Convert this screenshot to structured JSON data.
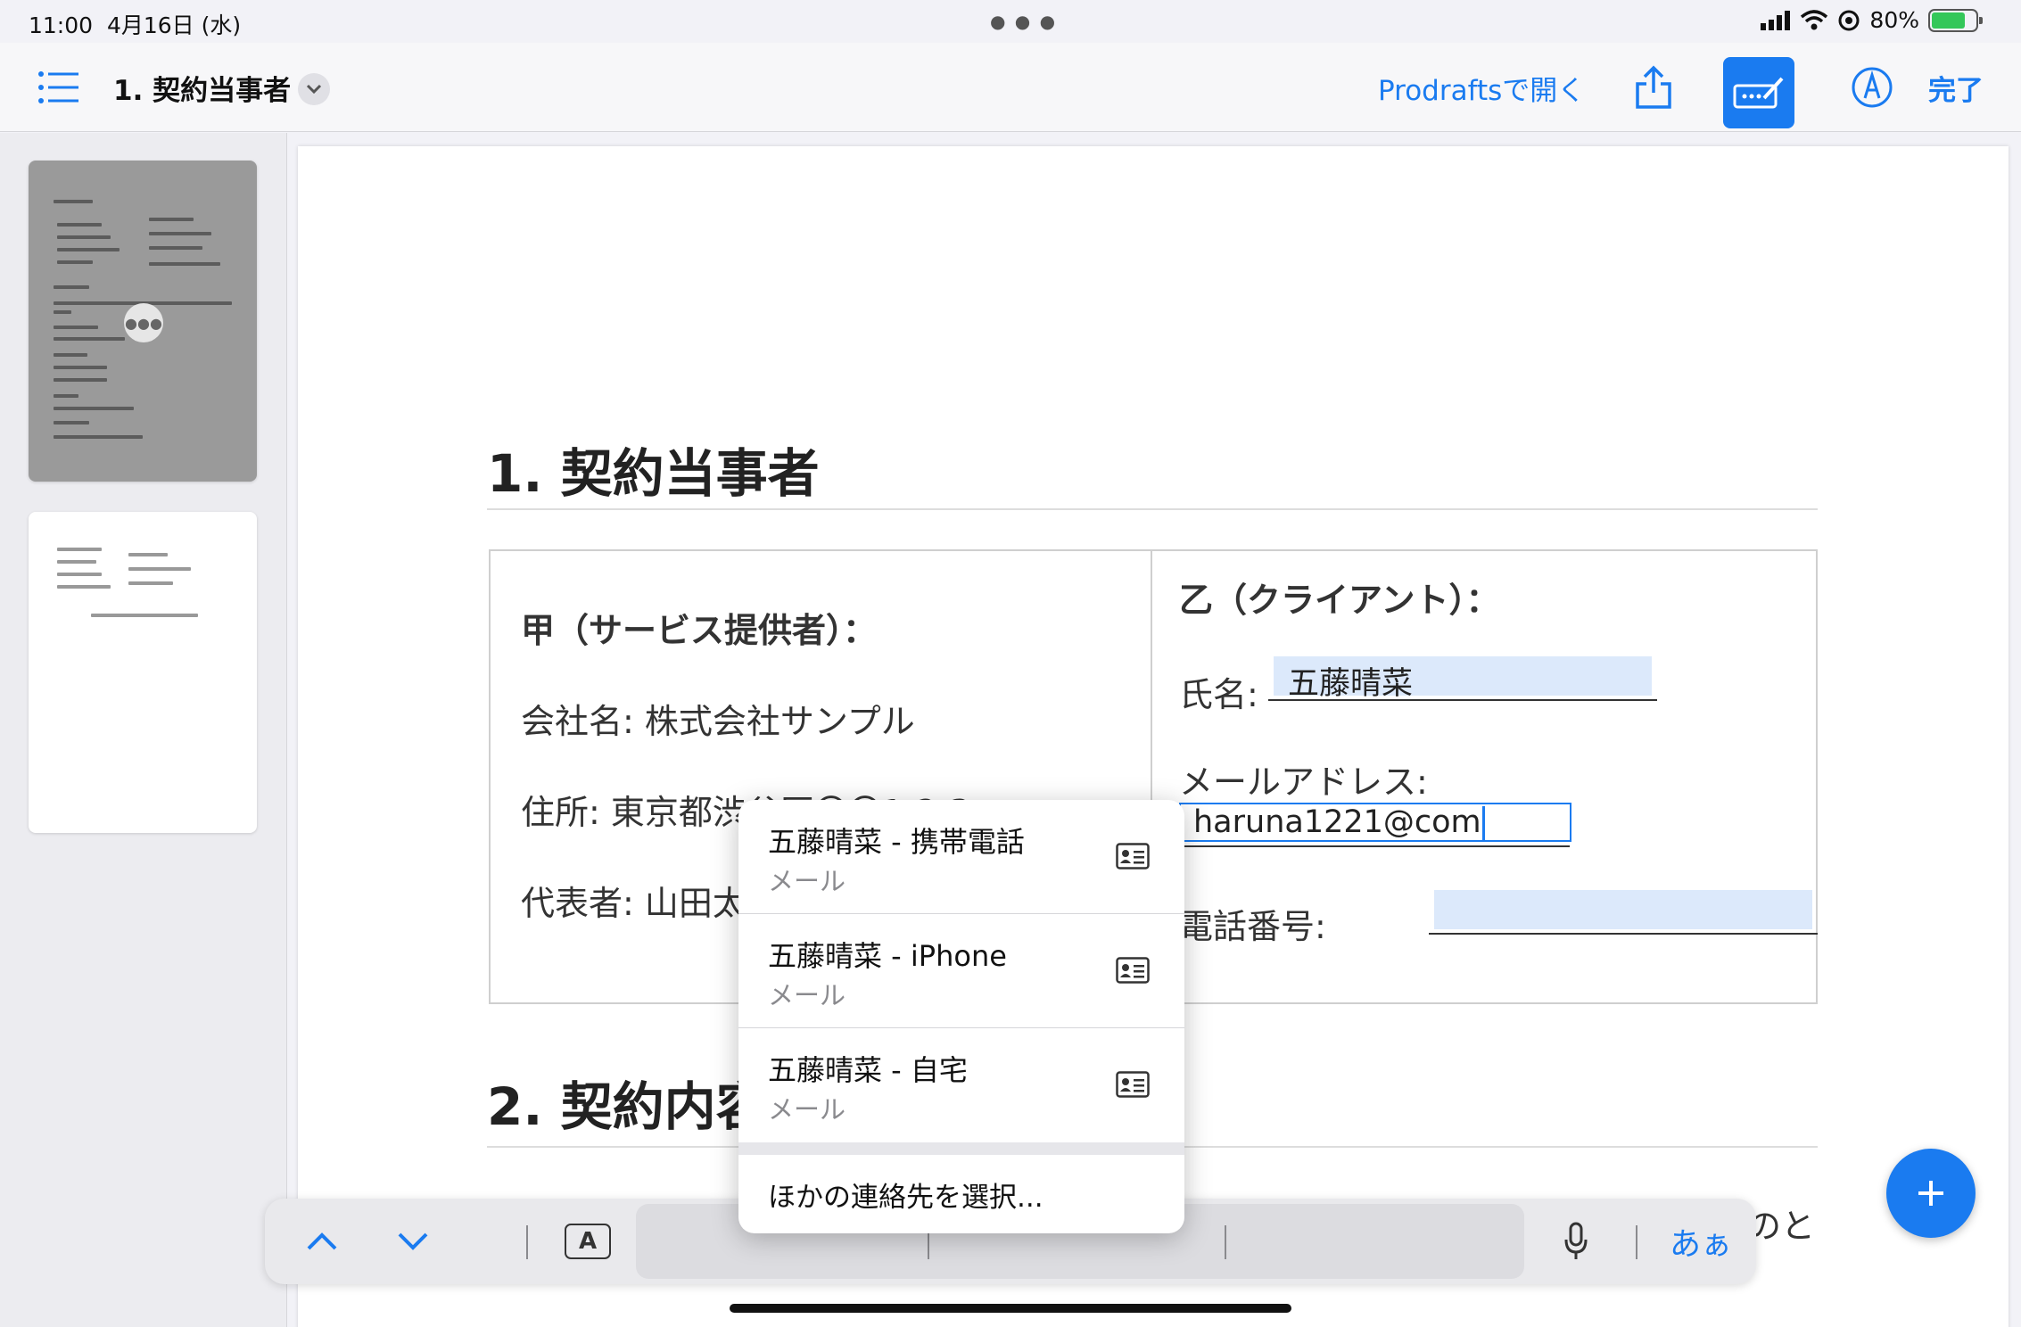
{
  "status": {
    "time": "11:00",
    "date": "4月16日 (水)",
    "battery": "80%",
    "battery_level": 0.8
  },
  "toolbar": {
    "title": "1. 契約当事者",
    "open_in": "Prodraftsで開く",
    "done": "完了"
  },
  "document": {
    "section1_title": "1. 契約当事者",
    "party_a": {
      "heading": "甲（サービス提供者）：",
      "company": "会社名: 株式会社サンプル",
      "address": "住所: 東京都渋谷区〇〇1-2-3",
      "representative": "代表者: 山田太郎"
    },
    "party_b": {
      "heading": "乙（クライアント）：",
      "name_label": "氏名:",
      "name_value": "五藤晴菜",
      "email_label": "メールアドレス:",
      "email_value": "haruna1221@com",
      "phone_label": "電話番号:",
      "phone_value": ""
    },
    "section2_title": "2. 契約内容",
    "trailing_text": "のと"
  },
  "autofill_popup": {
    "items": [
      {
        "name": "五藤晴菜 - 携帯電話",
        "type": "メール"
      },
      {
        "name": "五藤晴菜 - iPhone",
        "type": "メール"
      },
      {
        "name": "五藤晴菜 - 自宅",
        "type": "メール"
      }
    ],
    "other": "ほかの連絡先を選択..."
  },
  "keyboard_bar": {
    "format_key": "A",
    "language": "あぁ"
  },
  "colors": {
    "accent": "#1a7bf0",
    "field_fill": "#dce9fb"
  }
}
